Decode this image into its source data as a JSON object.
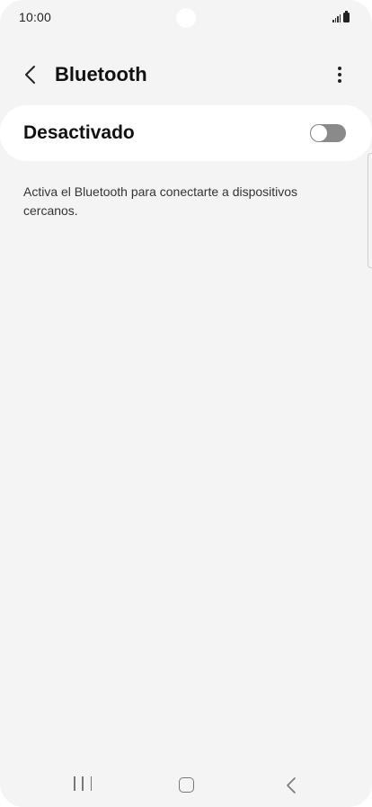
{
  "status_bar": {
    "time": "10:00",
    "icons": [
      "signal-icon",
      "battery-icon"
    ]
  },
  "header": {
    "title": "Bluetooth",
    "back_icon": "chevron-left-icon",
    "more_icon": "more-vertical-icon"
  },
  "bluetooth_toggle": {
    "label": "Desactivado",
    "state": "off"
  },
  "description": "Activa el Bluetooth para conectarte a dispositivos cercanos.",
  "nav_bar": {
    "icons": [
      "recents-icon",
      "home-icon",
      "back-icon"
    ]
  },
  "colors": {
    "background": "#f4f4f4",
    "card": "#ffffff",
    "toggle_off": "#8a8a8a",
    "text_primary": "#111111"
  }
}
